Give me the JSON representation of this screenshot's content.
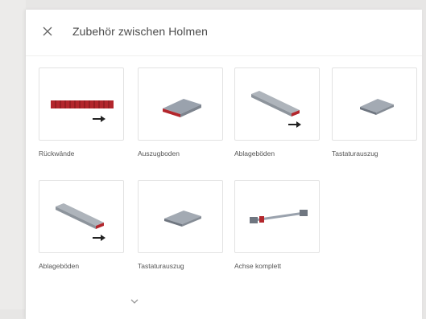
{
  "dialog": {
    "title": "Zubehör zwischen Holmen",
    "close_icon": "close-icon",
    "expand_icon": "chevron-down-icon"
  },
  "items": [
    {
      "label": "Rückwände",
      "icon": "back-panel-icon",
      "has_arrow": true
    },
    {
      "label": "Auszugboden",
      "icon": "pull-out-shelf-icon",
      "has_arrow": false
    },
    {
      "label": "Ablageböden",
      "icon": "shelf-board-icon",
      "has_arrow": true
    },
    {
      "label": "Tastaturauszug",
      "icon": "keyboard-tray-icon",
      "has_arrow": false
    },
    {
      "label": "Ablageböden",
      "icon": "shelf-board-icon",
      "has_arrow": true
    },
    {
      "label": "Tastaturauszug",
      "icon": "keyboard-tray-icon",
      "has_arrow": false
    },
    {
      "label": "Achse komplett",
      "icon": "axle-icon",
      "has_arrow": false
    }
  ],
  "colors": {
    "accent_red": "#b3262c",
    "panel_grey": "#9aa2ad"
  }
}
